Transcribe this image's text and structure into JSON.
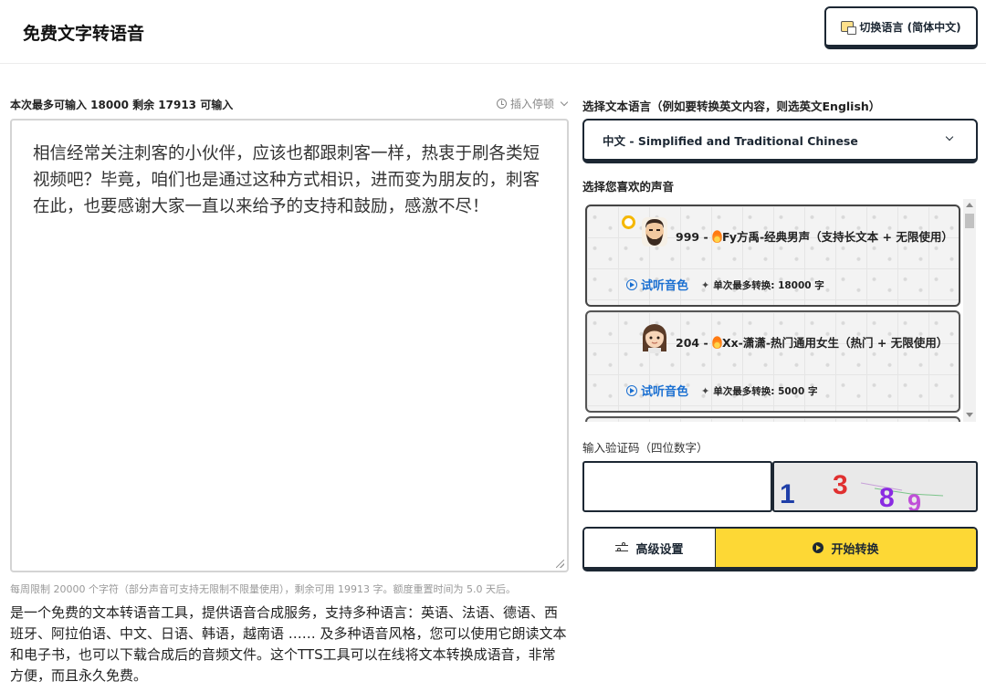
{
  "header": {
    "title": "免费文字转语音",
    "language_switch_label": "切换语言 (简体中文)"
  },
  "editor": {
    "limit_line": "本次最多可输入 18000 剩余 17913 可输入",
    "insert_pause_label": "插入停顿",
    "text": "相信经常关注刺客的小伙伴，应该也都跟刺客一样，热衷于刷各类短视频吧？毕竟，咱们也是通过这种方式相识，进而变为朋友的，刺客在此，也要感谢大家一直以来给予的支持和鼓励，感激不尽！",
    "quota_note": "每周限制 20000 个字符（部分声音可支持无限制不限量使用），剩余可用 19913 字。额度重置时间为 5.0 天后。",
    "description": "是一个免费的文本转语音工具，提供语音合成服务，支持多种语言：英语、法语、德语、西班牙、阿拉伯语、中文、日语、韩语，越南语 …… 及多种语音风格，您可以使用它朗读文本和电子书，也可以下载合成后的音频文件。这个TTS工具可以在线将文本转换成语音，非常方便，而且永久免费。"
  },
  "settings": {
    "text_language_label": "选择文本语言（例如要转换英文内容，则选英文English）",
    "selected_language": "中文 - Simplified and Traditional Chinese",
    "voice_label": "选择您喜欢的声音",
    "voices": [
      {
        "name_prefix": "999 - ",
        "name": "Fy方禹-经典男声（支持长文本 + 无限使用）",
        "listen_label": "试听音色",
        "max_label": "单次最多转换: 18000 字",
        "selected": true
      },
      {
        "name_prefix": "204 - ",
        "name": "Xx-潇潇-热门通用女生（热门 + 无限使用）",
        "listen_label": "试听音色",
        "max_label": "单次最多转换: 5000 字",
        "selected": false
      }
    ],
    "captcha_label": "输入验证码（四位数字）",
    "captcha_input_value": "",
    "captcha_digits": [
      "1",
      "3",
      "8",
      "9"
    ],
    "advanced_button": "高级设置",
    "start_button": "开始转换"
  },
  "colors": {
    "accent_yellow": "#fdd835",
    "border_dark": "#1c2733",
    "link_blue": "#1a6fd1"
  }
}
